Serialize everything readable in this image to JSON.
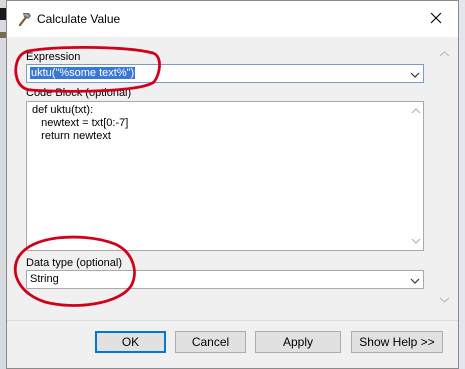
{
  "window": {
    "title": "Calculate Value"
  },
  "expression": {
    "label": "Expression",
    "value": "uktu(\"%some text%\")"
  },
  "code_block": {
    "label": "Code Block (optional)",
    "code": "def uktu(txt):\n   newtext = txt[0:-7]\n   return newtext"
  },
  "data_type": {
    "label": "Data type (optional)",
    "value": "String"
  },
  "buttons": {
    "ok": "OK",
    "cancel": "Cancel",
    "apply": "Apply",
    "show_help": "Show Help >>"
  },
  "icons": {
    "title": "hammer-icon",
    "close": "close-icon",
    "dropdown": "chevron-down-icon"
  },
  "colors": {
    "selection": "#3a78d8",
    "annotation": "#d0021b",
    "default_button_border": "#0078d7"
  }
}
